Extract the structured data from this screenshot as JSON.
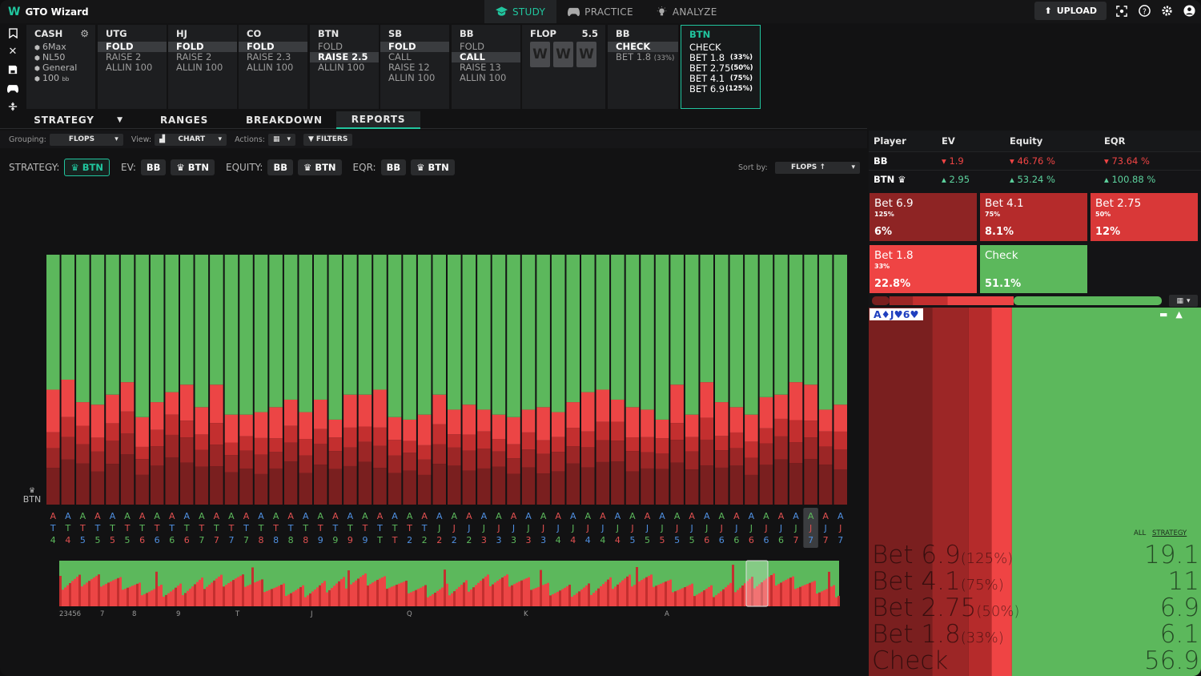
{
  "app": {
    "name": "GTO Wizard"
  },
  "nav": {
    "tabs": [
      {
        "label": "STUDY",
        "icon": "graduation-cap-icon"
      },
      {
        "label": "PRACTICE",
        "icon": "gamepad-icon"
      },
      {
        "label": "ANALYZE",
        "icon": "lightbulb-icon"
      }
    ],
    "active": 0,
    "upload_label": "UPLOAD"
  },
  "cash": {
    "title": "CASH",
    "rows": [
      "6Max",
      "NL50",
      "General",
      "100"
    ],
    "stack_unit": "bb"
  },
  "positions": [
    {
      "title": "UTG",
      "rows": [
        "FOLD",
        "RAISE 2",
        "ALLIN 100"
      ],
      "selected": 0
    },
    {
      "title": "HJ",
      "rows": [
        "FOLD",
        "RAISE 2",
        "ALLIN 100"
      ],
      "selected": 0
    },
    {
      "title": "CO",
      "rows": [
        "FOLD",
        "RAISE 2.3",
        "ALLIN 100"
      ],
      "selected": 0
    },
    {
      "title": "BTN",
      "rows": [
        "FOLD",
        "RAISE 2.5",
        "ALLIN 100"
      ],
      "selected": 1
    },
    {
      "title": "SB",
      "rows": [
        "FOLD",
        "CALL",
        "RAISE 12",
        "ALLIN 100"
      ],
      "selected": 0
    },
    {
      "title": "BB",
      "rows": [
        "FOLD",
        "CALL",
        "RAISE 13",
        "ALLIN 100"
      ],
      "selected": 1
    }
  ],
  "flop": {
    "title": "FLOP",
    "pot": "5.5",
    "cards": [
      "W",
      "W",
      "W"
    ]
  },
  "bb_card": {
    "title": "BB",
    "rows": [
      {
        "label": "CHECK",
        "pct": ""
      },
      {
        "label": "BET 1.8",
        "pct": "(33%)"
      }
    ],
    "selected": 0
  },
  "btn_card": {
    "title": "BTN",
    "rows": [
      {
        "label": "CHECK",
        "pct": ""
      },
      {
        "label": "BET 1.8",
        "pct": "(33%)"
      },
      {
        "label": "BET 2.75",
        "pct": "(50%)"
      },
      {
        "label": "BET 4.1",
        "pct": "(75%)"
      },
      {
        "label": "BET 6.9",
        "pct": "(125%)"
      }
    ]
  },
  "subtabs": [
    "STRATEGY",
    "RANGES",
    "BREAKDOWN",
    "REPORTS"
  ],
  "subtab_active": 3,
  "toolbar": {
    "grouping_label": "Grouping:",
    "grouping_value": "FLOPS",
    "view_label": "View:",
    "view_value": "CHART",
    "actions_label": "Actions:",
    "filters_label": "FILTERS"
  },
  "strategy_row": {
    "strategy_label": "STRATEGY:",
    "strategy_value": "BTN",
    "ev_label": "EV:",
    "equity_label": "EQUITY:",
    "eqr_label": "EQR:",
    "bb": "BB",
    "btn": "BTN",
    "sort_label": "Sort by:",
    "sort_value": "FLOPS"
  },
  "chart_data": {
    "type": "bar",
    "stacked": true,
    "player": "BTN",
    "categories": [
      "AT4",
      "AT4",
      "AT5",
      "AT5",
      "AT5",
      "AT5",
      "AT6",
      "AT6",
      "AT6",
      "AT6",
      "AT7",
      "AT7",
      "AT7",
      "AT7",
      "AT8",
      "AT8",
      "AT8",
      "AT8",
      "AT9",
      "AT9",
      "AT9",
      "AT9",
      "ATT",
      "ATT",
      "AJ2",
      "AJ2",
      "AJ2",
      "AJ2",
      "AJ3",
      "AJ3",
      "AJ3",
      "AJ3",
      "AJ4",
      "AJ4",
      "AJ4",
      "AJ4",
      "AJ5",
      "AJ5",
      "AJ5",
      "AJ5",
      "AJ6",
      "AJ6",
      "AJ6",
      "AJ6",
      "AJ6",
      "AJ7",
      "AJ7"
    ],
    "labels_line1": [
      "A",
      "A",
      "A",
      "A",
      "A",
      "A",
      "A",
      "A",
      "A",
      "A",
      "A",
      "A",
      "A",
      "A",
      "A",
      "A",
      "A",
      "A",
      "A",
      "A",
      "A",
      "A",
      "A",
      "A",
      "A",
      "A",
      "A",
      "A",
      "A",
      "A",
      "A",
      "A",
      "A",
      "A",
      "A",
      "A",
      "A",
      "A",
      "A",
      "A",
      "A",
      "A",
      "A",
      "A",
      "A",
      "A",
      "A",
      "A",
      "A",
      "A",
      "A",
      "A",
      "A",
      "A"
    ],
    "labels_line2": [
      "T",
      "T",
      "T",
      "T",
      "T",
      "T",
      "T",
      "T",
      "T",
      "T",
      "T",
      "T",
      "T",
      "T",
      "T",
      "T",
      "T",
      "T",
      "T",
      "T",
      "T",
      "T",
      "T",
      "T",
      "T",
      "T",
      "J",
      "J",
      "J",
      "J",
      "J",
      "J",
      "J",
      "J",
      "J",
      "J",
      "J",
      "J",
      "J",
      "J",
      "J",
      "J",
      "J",
      "J",
      "J",
      "J",
      "J",
      "J",
      "J",
      "J",
      "J",
      "J",
      "J",
      "J"
    ],
    "labels_line3": [
      "4",
      "4",
      "5",
      "5",
      "5",
      "5",
      "6",
      "6",
      "6",
      "6",
      "7",
      "7",
      "7",
      "7",
      "8",
      "8",
      "8",
      "8",
      "9",
      "9",
      "9",
      "9",
      "T",
      "T",
      "2",
      "2",
      "2",
      "2",
      "2",
      "3",
      "3",
      "3",
      "3",
      "3",
      "4",
      "4",
      "4",
      "4",
      "4",
      "5",
      "5",
      "5",
      "5",
      "5",
      "6",
      "6",
      "6",
      "6",
      "6",
      "6",
      "7",
      "7",
      "7",
      "7"
    ],
    "suit_colors": [
      "r",
      "b",
      "g",
      "r",
      "b",
      "g",
      "r",
      "g",
      "r",
      "b",
      "g",
      "r",
      "g",
      "r",
      "b",
      "g",
      "r",
      "b",
      "g",
      "r",
      "b",
      "g",
      "r",
      "b",
      "g",
      "r",
      "b",
      "g",
      "r",
      "b",
      "g",
      "r",
      "b",
      "g",
      "r",
      "b",
      "g",
      "r",
      "b",
      "g",
      "r",
      "b",
      "g",
      "r",
      "b",
      "g",
      "r",
      "b",
      "g",
      "r",
      "b",
      "g",
      "r",
      "b"
    ],
    "series": [
      {
        "name": "Bet 6.9",
        "color": "#7a1f1f"
      },
      {
        "name": "Bet 4.1",
        "color": "#9c2626"
      },
      {
        "name": "Bet 2.75",
        "color": "#c32f2f"
      },
      {
        "name": "Bet 1.8",
        "color": "#ec4545"
      },
      {
        "name": "Check",
        "color": "#5cb85c"
      }
    ],
    "check_pct": [
      54,
      50,
      59,
      60,
      56,
      51,
      65,
      59,
      55,
      52,
      61,
      52,
      64,
      64,
      63,
      61,
      58,
      63,
      58,
      66,
      56,
      56,
      54,
      65,
      66,
      64,
      56,
      62,
      60,
      62,
      64,
      65,
      62,
      61,
      63,
      59,
      55,
      54,
      58,
      61,
      62,
      66,
      52,
      64,
      51,
      59,
      61,
      64,
      57,
      56,
      51,
      52,
      62,
      60
    ],
    "ylim": [
      0,
      100
    ]
  },
  "minimap": {
    "ticks": [
      "23456",
      "7",
      "8",
      "9",
      "T",
      "J",
      "Q",
      "K",
      "A"
    ]
  },
  "eqtable": {
    "headers": [
      "Player",
      "EV",
      "Equity",
      "EQR"
    ],
    "rows": [
      {
        "player": "BB",
        "ev": "1.9",
        "equity": "46.76 %",
        "eqr": "73.64 %",
        "dir": "down"
      },
      {
        "player": "BTN",
        "ev": "2.95",
        "equity": "53.24 %",
        "eqr": "100.88 %",
        "dir": "up"
      }
    ]
  },
  "tiles": [
    {
      "name": "Bet 6.9",
      "pct": "125%",
      "value": "6%",
      "color": "#8e2424"
    },
    {
      "name": "Bet 4.1",
      "pct": "75%",
      "value": "8.1%",
      "color": "#b52b2b"
    },
    {
      "name": "Bet 2.75",
      "pct": "50%",
      "value": "12%",
      "color": "#d93838"
    },
    {
      "name": "Bet 1.8",
      "pct": "33%",
      "value": "22.8%",
      "color": "#ef4444"
    },
    {
      "name": "Check",
      "pct": "",
      "value": "51.1%",
      "color": "#5cb85c"
    }
  ],
  "freq_bar": [
    6,
    8.1,
    12,
    22.8,
    51.1
  ],
  "hand": {
    "label": "A♦J♥6♥",
    "all_label": "ALL",
    "strategy_label": "STRATEGY"
  },
  "hand_breakdown": [
    {
      "label": "Bet 6.9",
      "pct": "(125%)",
      "value": "19.1"
    },
    {
      "label": "Bet 4.1",
      "pct": "(75%)",
      "value": "11"
    },
    {
      "label": "Bet 2.75",
      "pct": "(50%)",
      "value": "6.9"
    },
    {
      "label": "Bet 1.8",
      "pct": "(33%)",
      "value": "6.1"
    },
    {
      "label": "Check",
      "pct": "",
      "value": "56.9"
    }
  ]
}
